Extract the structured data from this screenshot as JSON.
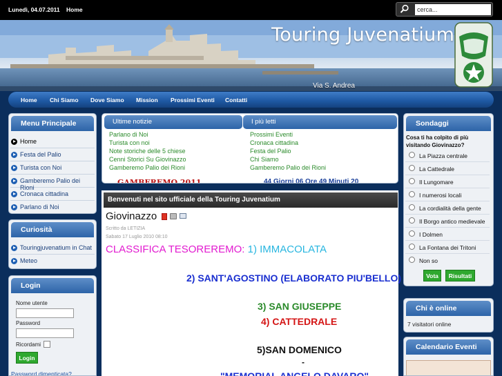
{
  "topbar": {
    "date": "Lunedì, 04.07.2011",
    "home": "Home",
    "search_placeholder": "cerca..."
  },
  "header": {
    "title": "Touring Juvenatium",
    "caption": "Via S. Andrea"
  },
  "nav": {
    "items": [
      "Home",
      "Chi Siamo",
      "Dove Siamo",
      "Mission",
      "Prossimi Eventi",
      "Contatti"
    ]
  },
  "menu": {
    "title": "Menu Principale",
    "items": [
      "Home",
      "Festa del Palio",
      "Turista con Noi",
      "Gamberemo Palio dei Rioni",
      "Cronaca cittadina",
      "Parlano di Noi"
    ]
  },
  "curiosita": {
    "title": "Curiosità",
    "items": [
      "Touringjuvenatium in Chat",
      "Meteo"
    ]
  },
  "login": {
    "title": "Login",
    "username_label": "Nome utente",
    "password_label": "Password",
    "remember_label": "Ricordami",
    "button": "Login",
    "forgot": "Password dimenticata?"
  },
  "news": {
    "latest_title": "Ultime notizie",
    "latest": [
      "Parlano di Noi",
      "Turista con noi",
      "Note storiche delle 5 chiese",
      "Cenni Storici Su Giovinazzo",
      "Gamberemo Palio dei Rioni"
    ],
    "popular_title": "I più letti",
    "popular": [
      "Prossimi Eventi",
      "Cronaca cittadina",
      "Festa del Palio",
      "Chi Siamo",
      "Gamberemo Palio dei Rioni"
    ],
    "ticker_left": "GAMBEREMO 2011",
    "ticker_right": "44 Giorni 06 Ore 49 Minuti 20"
  },
  "article": {
    "banner": "Benvenuti nel sito ufficiale della Touring Juvenatium",
    "title": "Giovinazzo",
    "author": "Scritto da LETIZIA",
    "date": "Sabato 17 Luglio 2010 08:10",
    "line1_prefix": "CLASSIFICA TESOREREMO: ",
    "line1_value": "1) IMMACOLATA",
    "line2": "2) SANT'AGOSTINO (ELABORATO PIU'BELLO)",
    "line3": "3) SAN GIUSEPPE",
    "line4": "4) CATTEDRALE",
    "line5": "5)SAN DOMENICO",
    "line6": "-",
    "line7": "\"MEMORIAL ANGELO DAVARO\""
  },
  "poll": {
    "title": "Sondaggi",
    "question": "Cosa ti ha colpito di più visitando Giovinazzo?",
    "options": [
      "La Piazza centrale",
      "La Cattedrale",
      "Il Lungomare",
      "I numerosi locali",
      "La cordialità della gente",
      "Il Borgo antico medievale",
      "I Dolmen",
      "La Fontana dei Tritoni",
      "Non so"
    ],
    "vote": "Vota",
    "results": "Risultati"
  },
  "online": {
    "title": "Chi è online",
    "text": "7 visitatori online"
  },
  "calendar": {
    "title": "Calendario Eventi"
  },
  "colors": {
    "nav_blue": "#1f5aa5",
    "dark_navy": "#0b2e5c",
    "green_button": "#2fa82f",
    "link_green": "#2a8a2a"
  }
}
